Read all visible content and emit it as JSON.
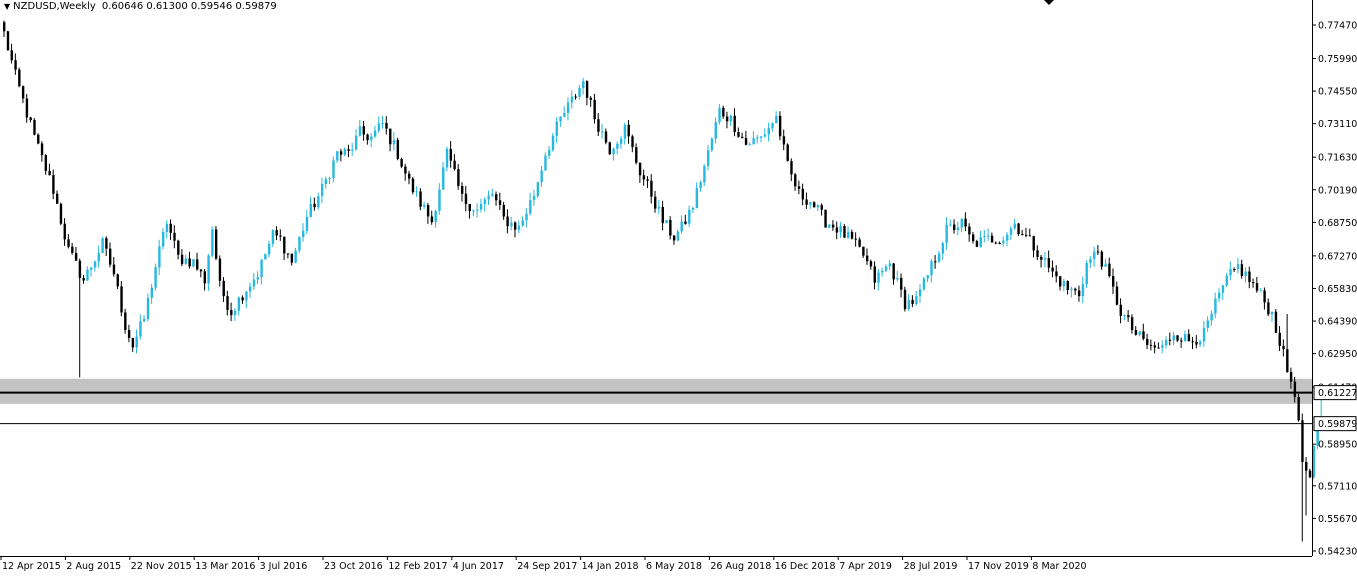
{
  "header": {
    "symbol": "NZDUSD,Weekly",
    "ohlc": "0.60646 0.61300 0.59546 0.59879"
  },
  "colors": {
    "bull": "#26b8e0",
    "bear": "#000000",
    "zone": "#c3c3c3",
    "background": "#ffffff"
  },
  "chart_data": {
    "type": "candlestick",
    "symbol": "NZDUSD",
    "timeframe": "Weekly",
    "x_axis": {
      "tick_labels": [
        "12 Apr 2015",
        "2 Aug 2015",
        "22 Nov 2015",
        "13 Mar 2016",
        "3 Jul 2016",
        "23 Oct 2016",
        "12 Feb 2017",
        "4 Jun 2017",
        "24 Sep 2017",
        "14 Jan 2018",
        "6 May 2018",
        "26 Aug 2018",
        "16 Dec 2018",
        "7 Apr 2019",
        "28 Jul 2019",
        "17 Nov 2019",
        "8 Mar 2020"
      ]
    },
    "y_axis": {
      "range": [
        0.5423,
        0.7862
      ],
      "tick_labels": [
        "0.77470",
        "0.75990",
        "0.74550",
        "0.73110",
        "0.71630",
        "0.70190",
        "0.68750",
        "0.67270",
        "0.65830",
        "0.64390",
        "0.62950",
        "0.61470",
        "0.58950",
        "0.57110",
        "0.55670",
        "0.54230"
      ]
    },
    "price_lines": [
      {
        "label": "0.61227",
        "value": 0.61227,
        "style": "resistance"
      },
      {
        "label": "0.59879",
        "value": 0.59879,
        "style": "current"
      }
    ],
    "zone": {
      "low": 0.6073,
      "high": 0.6184
    },
    "price_path": [
      [
        0,
        0.771
      ],
      [
        3,
        0.752
      ],
      [
        8,
        0.725
      ],
      [
        13,
        0.702
      ],
      [
        17,
        0.675
      ],
      [
        21,
        0.662
      ],
      [
        26,
        0.678
      ],
      [
        29,
        0.665
      ],
      [
        32,
        0.642
      ],
      [
        34,
        0.633
      ],
      [
        37,
        0.645
      ],
      [
        40,
        0.668
      ],
      [
        43,
        0.688
      ],
      [
        46,
        0.672
      ],
      [
        50,
        0.67
      ],
      [
        53,
        0.662
      ],
      [
        55,
        0.685
      ],
      [
        57,
        0.659
      ],
      [
        60,
        0.648
      ],
      [
        63,
        0.656
      ],
      [
        67,
        0.665
      ],
      [
        71,
        0.682
      ],
      [
        73,
        0.68
      ],
      [
        76,
        0.67
      ],
      [
        80,
        0.69
      ],
      [
        84,
        0.702
      ],
      [
        88,
        0.718
      ],
      [
        91,
        0.718
      ],
      [
        94,
        0.727
      ],
      [
        97,
        0.725
      ],
      [
        100,
        0.731
      ],
      [
        104,
        0.718
      ],
      [
        107,
        0.705
      ],
      [
        110,
        0.696
      ],
      [
        113,
        0.688
      ],
      [
        117,
        0.718
      ],
      [
        121,
        0.698
      ],
      [
        125,
        0.693
      ],
      [
        129,
        0.7
      ],
      [
        132,
        0.689
      ],
      [
        136,
        0.685
      ],
      [
        140,
        0.7
      ],
      [
        143,
        0.718
      ],
      [
        147,
        0.733
      ],
      [
        151,
        0.744
      ],
      [
        153,
        0.75
      ],
      [
        156,
        0.734
      ],
      [
        160,
        0.72
      ],
      [
        164,
        0.729
      ],
      [
        168,
        0.71
      ],
      [
        171,
        0.7
      ],
      [
        174,
        0.688
      ],
      [
        177,
        0.681
      ],
      [
        179,
        0.685
      ],
      [
        182,
        0.695
      ],
      [
        186,
        0.718
      ],
      [
        189,
        0.737
      ],
      [
        192,
        0.733
      ],
      [
        196,
        0.722
      ],
      [
        200,
        0.725
      ],
      [
        204,
        0.734
      ],
      [
        207,
        0.712
      ],
      [
        210,
        0.7
      ],
      [
        213,
        0.697
      ],
      [
        217,
        0.688
      ],
      [
        220,
        0.685
      ],
      [
        224,
        0.679
      ],
      [
        227,
        0.673
      ],
      [
        230,
        0.662
      ],
      [
        234,
        0.669
      ],
      [
        238,
        0.652
      ],
      [
        241,
        0.653
      ],
      [
        243,
        0.66
      ],
      [
        246,
        0.672
      ],
      [
        249,
        0.684
      ],
      [
        253,
        0.687
      ],
      [
        256,
        0.678
      ],
      [
        260,
        0.68
      ],
      [
        264,
        0.681
      ],
      [
        267,
        0.687
      ],
      [
        270,
        0.681
      ],
      [
        273,
        0.675
      ],
      [
        277,
        0.665
      ],
      [
        281,
        0.658
      ],
      [
        284,
        0.656
      ],
      [
        286,
        0.669
      ],
      [
        289,
        0.675
      ],
      [
        292,
        0.662
      ],
      [
        295,
        0.648
      ],
      [
        299,
        0.638
      ],
      [
        303,
        0.632
      ],
      [
        306,
        0.632
      ],
      [
        309,
        0.639
      ],
      [
        313,
        0.635
      ],
      [
        317,
        0.638
      ],
      [
        320,
        0.651
      ],
      [
        323,
        0.662
      ],
      [
        326,
        0.668
      ],
      [
        329,
        0.662
      ],
      [
        332,
        0.655
      ],
      [
        335,
        0.647
      ],
      [
        337,
        0.635
      ],
      [
        339,
        0.622
      ],
      [
        341,
        0.613
      ],
      [
        343,
        0.582
      ],
      [
        345,
        0.572
      ],
      [
        346,
        0.587
      ],
      [
        347,
        0.595
      ],
      [
        348,
        0.5988
      ]
    ]
  }
}
